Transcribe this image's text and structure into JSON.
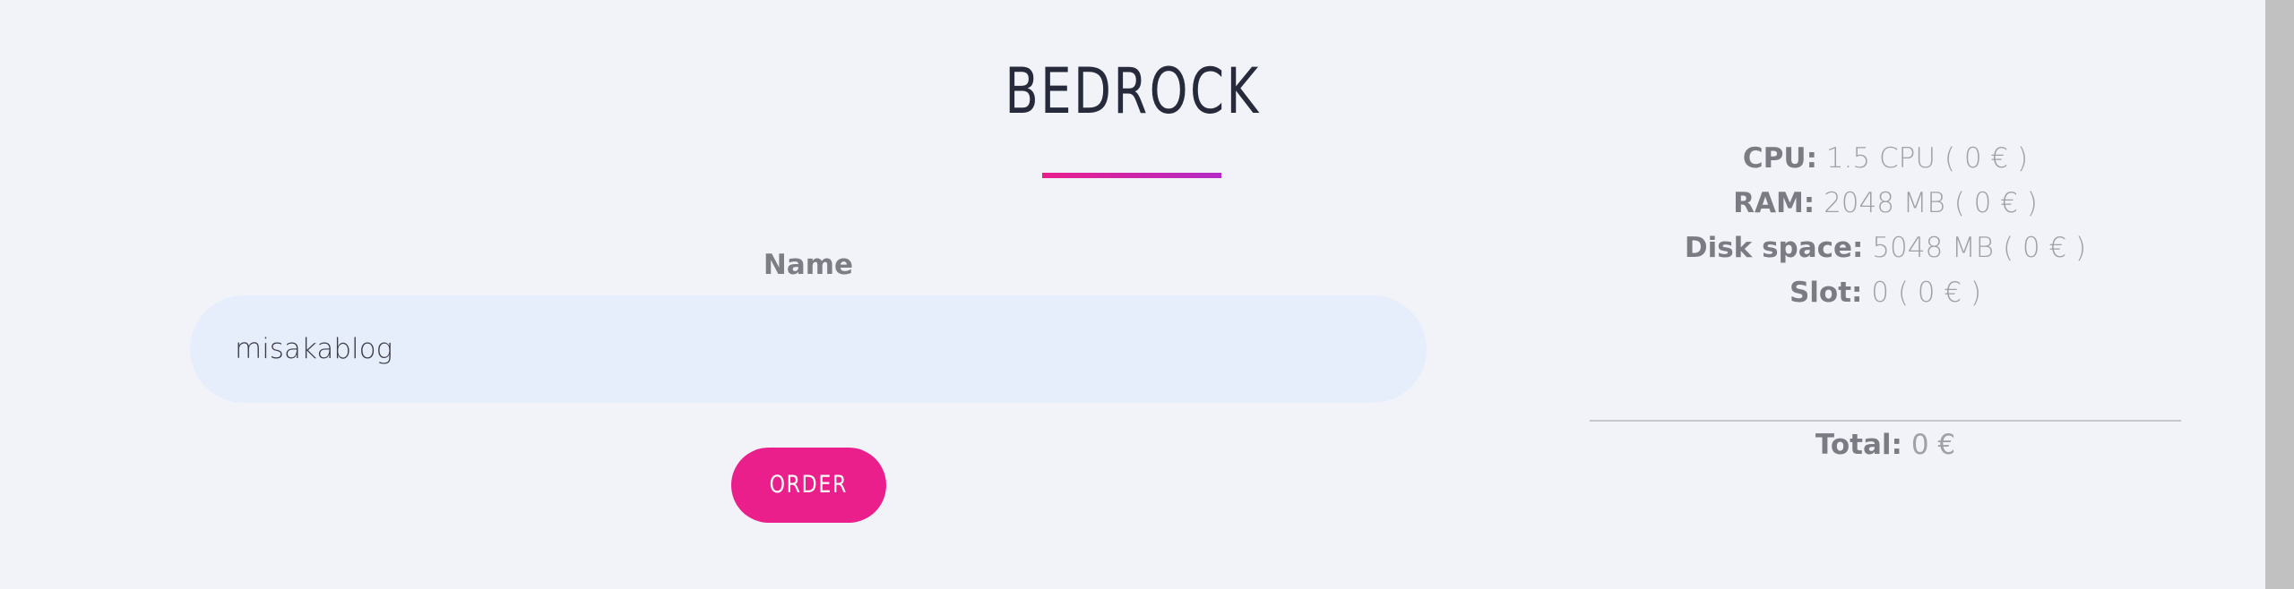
{
  "product": {
    "title": "BEDROCK",
    "accent_color": "#e91e8c",
    "accent_color_end": "#b22bc5"
  },
  "form": {
    "name_label": "Name",
    "name_value": "misakablog",
    "order_button_label": "ORDER",
    "order_button_color": "#ea1f8c"
  },
  "specs": {
    "cpu_label": "CPU:",
    "cpu_value": "1.5 CPU ( 0 € )",
    "ram_label": "RAM:",
    "ram_value": "2048 MB ( 0 € )",
    "disk_label": "Disk space:",
    "disk_value": "5048 MB ( 0 € )",
    "slot_label": "Slot:",
    "slot_value": "0 ( 0 € )"
  },
  "summary": {
    "total_label": "Total:",
    "total_value": "0 €"
  }
}
